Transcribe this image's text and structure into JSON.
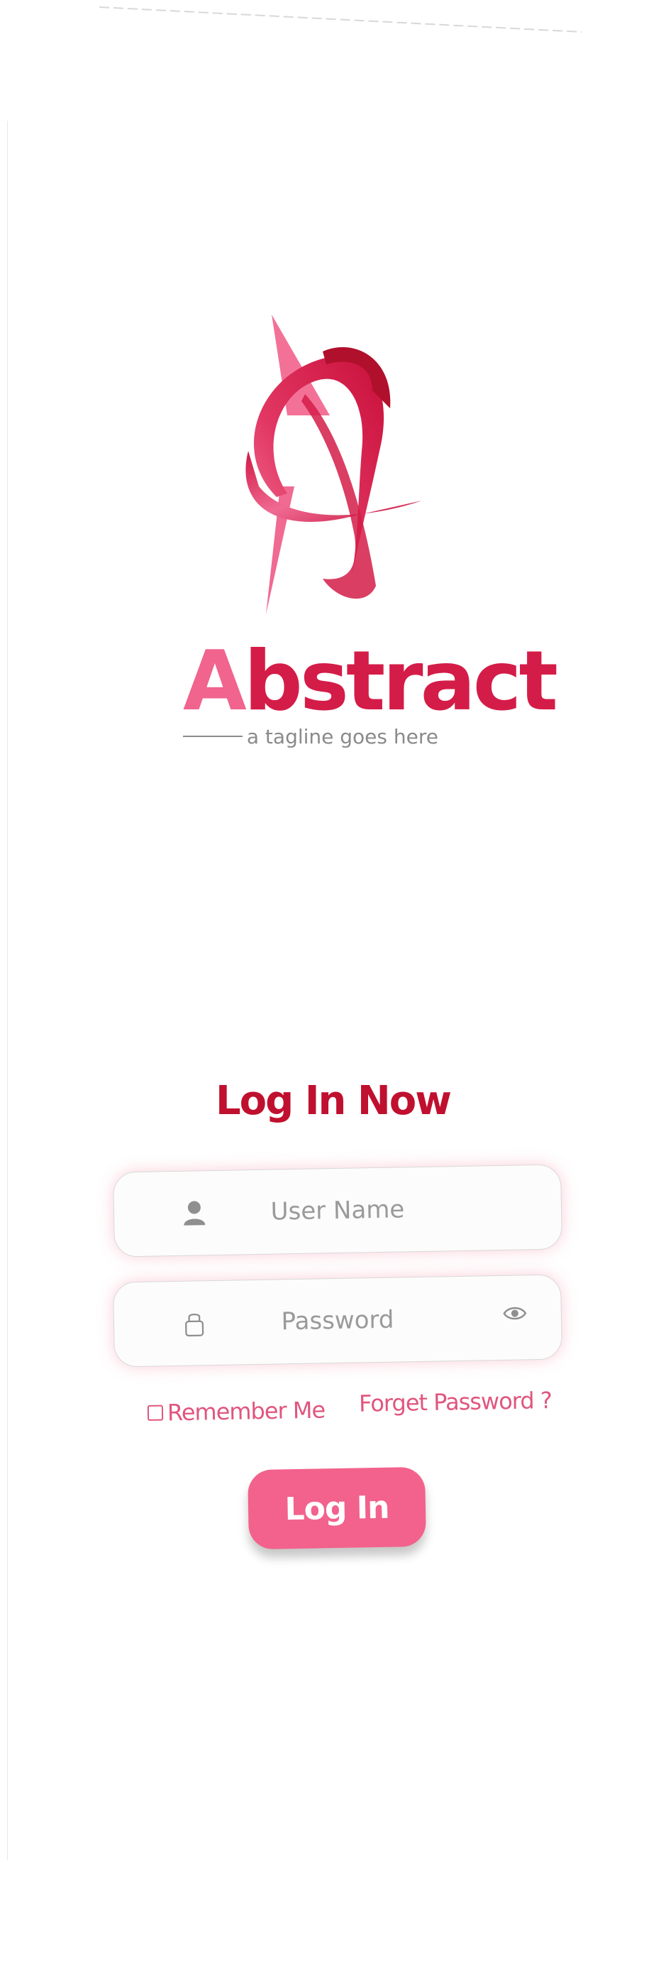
{
  "logo": {
    "brand_initial": "A",
    "brand_rest": "bstract",
    "tagline": "a tagline goes here",
    "colors": {
      "pink": "#f2628c",
      "crimson": "#d41c48",
      "dark_red": "#b0102c"
    }
  },
  "login": {
    "title": "Log In Now",
    "username": {
      "placeholder": "User Name",
      "value": "",
      "icon": "user-icon"
    },
    "password": {
      "placeholder": "Password",
      "value": "",
      "icon": "lock-icon",
      "toggle_icon": "eye-icon"
    },
    "remember_label": "Remember Me",
    "remember_checked": false,
    "forgot_label": "Forget Password ?",
    "submit_label": "Log In"
  },
  "theme": {
    "accent": "#f2628c",
    "title_color": "#c0102f",
    "link_color": "#e0567e",
    "placeholder_color": "#9a9a9a"
  }
}
